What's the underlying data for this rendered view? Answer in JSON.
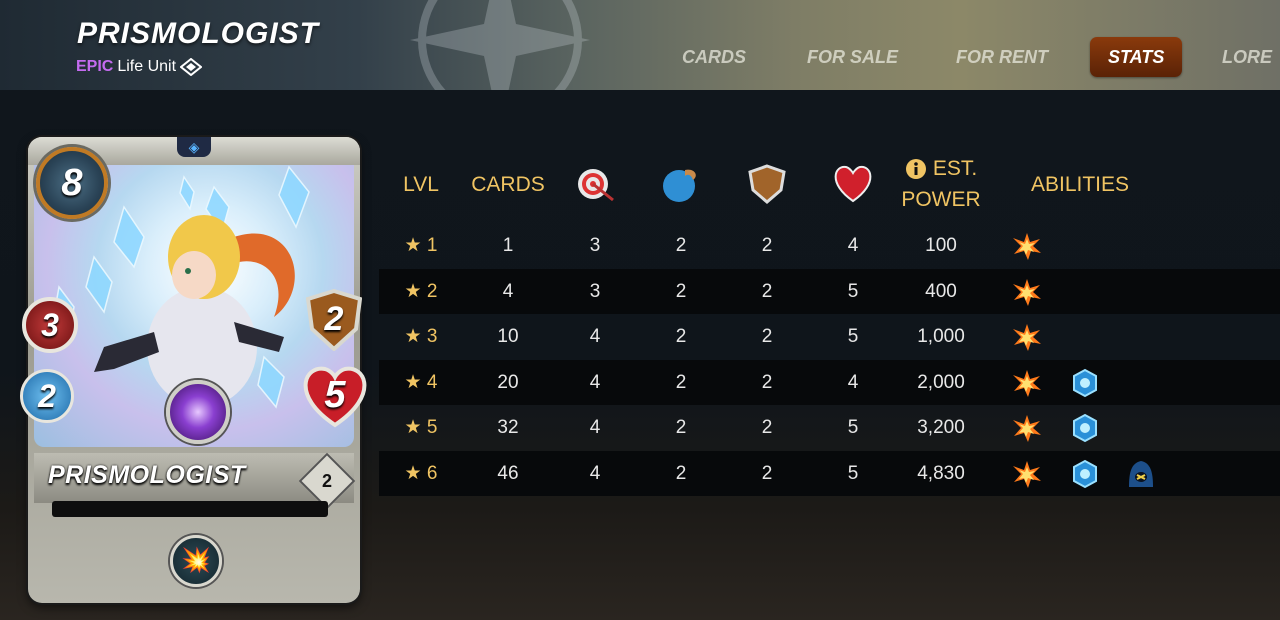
{
  "header": {
    "title": "PRISMOLOGIST",
    "rarity": "EPIC",
    "unit_type": "Life Unit",
    "nav": [
      {
        "label": "CARDS",
        "active": false
      },
      {
        "label": "FOR SALE",
        "active": false
      },
      {
        "label": "FOR RENT",
        "active": false
      },
      {
        "label": "STATS",
        "active": true
      },
      {
        "label": "LORE",
        "active": false
      }
    ]
  },
  "card": {
    "name": "PRISMOLOGIST",
    "mana": "8",
    "ranged": "3",
    "speed": "2",
    "armor": "2",
    "health": "5",
    "level": "2",
    "ability_icon": "blast-icon"
  },
  "table": {
    "headers": {
      "lvl": "LVL",
      "cards": "CARDS",
      "ranged_icon": "ranged-attack-icon",
      "speed_icon": "speed-icon",
      "armor_icon": "armor-icon",
      "health_icon": "health-icon",
      "power_line1": "EST.",
      "power_line2": "POWER",
      "abilities": "ABILITIES"
    },
    "rows": [
      {
        "lvl": "1",
        "cards": "1",
        "ranged": "3",
        "speed": "2",
        "armor": "2",
        "health": "4",
        "power": "100",
        "abilities": [
          "blast-icon"
        ]
      },
      {
        "lvl": "2",
        "cards": "4",
        "ranged": "3",
        "speed": "2",
        "armor": "2",
        "health": "5",
        "power": "400",
        "abilities": [
          "blast-icon"
        ]
      },
      {
        "lvl": "3",
        "cards": "10",
        "ranged": "4",
        "speed": "2",
        "armor": "2",
        "health": "5",
        "power": "1,000",
        "abilities": [
          "blast-icon"
        ]
      },
      {
        "lvl": "4",
        "cards": "20",
        "ranged": "4",
        "speed": "2",
        "armor": "2",
        "health": "4",
        "power": "2,000",
        "abilities": [
          "blast-icon",
          "divine-shield-icon"
        ]
      },
      {
        "lvl": "5",
        "cards": "32",
        "ranged": "4",
        "speed": "2",
        "armor": "2",
        "health": "5",
        "power": "3,200",
        "abilities": [
          "blast-icon",
          "divine-shield-icon"
        ]
      },
      {
        "lvl": "6",
        "cards": "46",
        "ranged": "4",
        "speed": "2",
        "armor": "2",
        "health": "5",
        "power": "4,830",
        "abilities": [
          "blast-icon",
          "divine-shield-icon",
          "cloak-icon"
        ]
      }
    ]
  },
  "colors": {
    "header_gold": "#f0c463",
    "rarity_purple": "#c46bf0",
    "active_tab": "#8a3a0c"
  }
}
